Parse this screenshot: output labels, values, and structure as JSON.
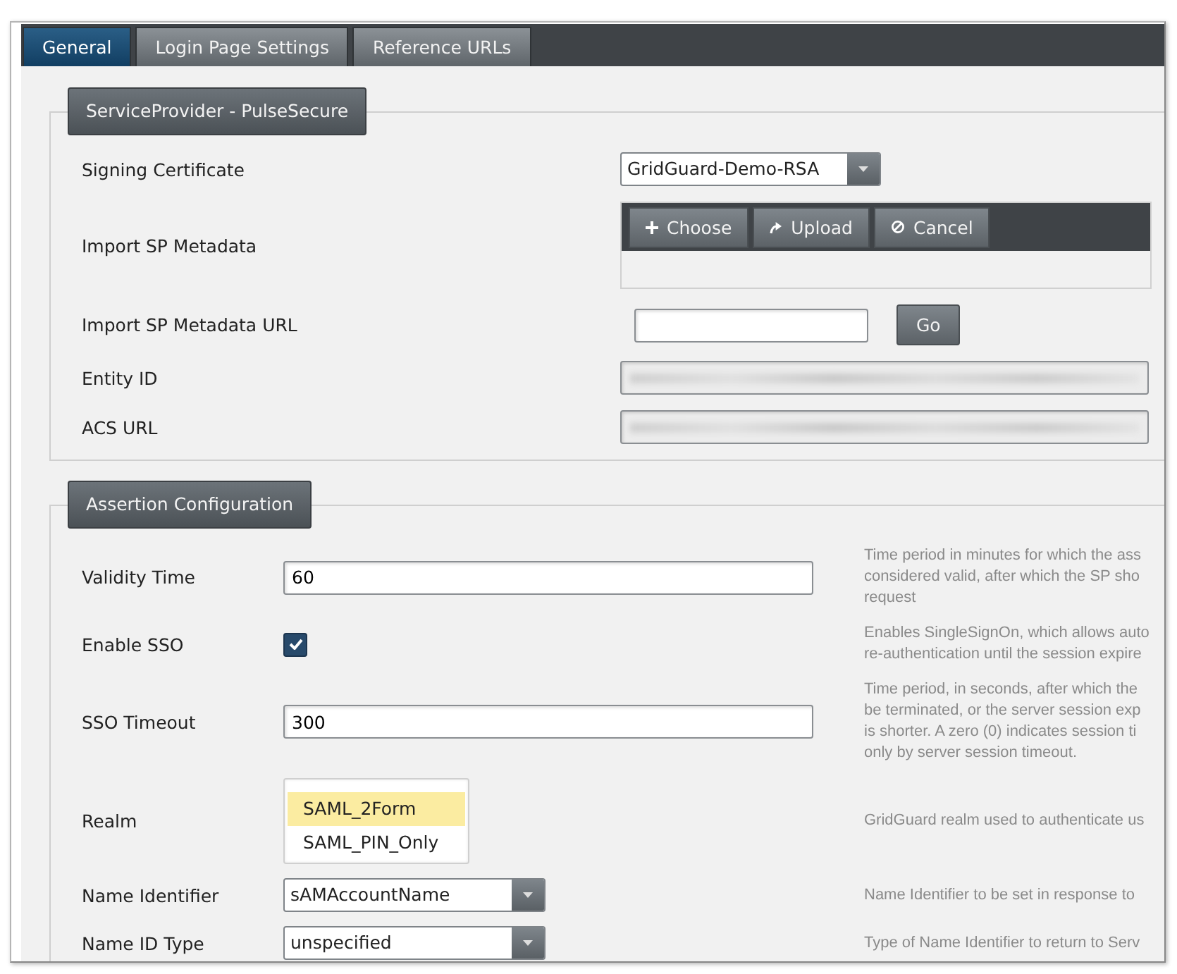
{
  "tabs": [
    {
      "label": "General",
      "selected": true
    },
    {
      "label": "Login Page Settings",
      "selected": false
    },
    {
      "label": "Reference URLs",
      "selected": false
    }
  ],
  "sections": [
    {
      "legend": "ServiceProvider - PulseSecure",
      "rows": [
        {
          "kind": "select",
          "label": "Signing Certificate",
          "value": "GridGuard-Demo-RSA"
        },
        {
          "kind": "upload",
          "label": "Import SP Metadata",
          "buttons": [
            {
              "label": "Choose"
            },
            {
              "label": "Upload"
            },
            {
              "label": "Cancel"
            }
          ]
        },
        {
          "kind": "url",
          "label": "Import SP Metadata URL",
          "button": "Go"
        },
        {
          "kind": "blurred",
          "label": "Entity ID"
        },
        {
          "kind": "blurred",
          "label": "ACS URL"
        }
      ]
    },
    {
      "legend": "Assertion Configuration",
      "rows": [
        {
          "kind": "text",
          "label": "Validity Time",
          "value": "60",
          "help": [
            "Time period in minutes for which the ass",
            "considered valid, after which the SP sho",
            "request"
          ]
        },
        {
          "kind": "checkbox",
          "label": "Enable SSO",
          "checked": true,
          "help": [
            "Enables SingleSignOn, which allows auto",
            "re-authentication until the session expire"
          ]
        },
        {
          "kind": "text",
          "label": "SSO Timeout",
          "value": "300",
          "help": [
            "Time period, in seconds, after which the",
            "be terminated, or the server session exp",
            "is shorter. A zero (0) indicates session ti",
            "only by server session timeout."
          ]
        },
        {
          "kind": "list",
          "label": "Realm",
          "options": [
            {
              "label": "SAML_2Form",
              "selected": true
            },
            {
              "label": "SAML_PIN_Only",
              "selected": false
            }
          ],
          "help": [
            "GridGuard realm used to authenticate us"
          ]
        },
        {
          "kind": "select",
          "label": "Name Identifier",
          "value": "sAMAccountName",
          "help": [
            "Name Identifier to be set in response to"
          ]
        },
        {
          "kind": "select",
          "label": "Name ID Type",
          "value": "unspecified",
          "help": [
            "Type of Name Identifier to return to Serv"
          ]
        }
      ]
    }
  ]
}
